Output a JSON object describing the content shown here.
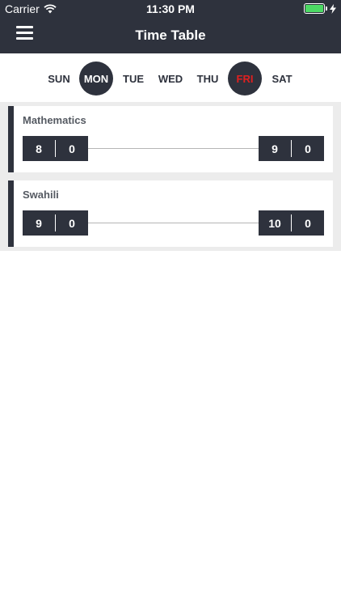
{
  "status_bar": {
    "carrier": "Carrier",
    "time": "11:30 PM",
    "battery_color": "#4cd964"
  },
  "header": {
    "title": "Time Table",
    "menu_icon": "hamburger-menu-icon",
    "background": "#2e323d"
  },
  "days": [
    {
      "label": "SUN",
      "state": "normal"
    },
    {
      "label": "MON",
      "state": "selected"
    },
    {
      "label": "TUE",
      "state": "normal"
    },
    {
      "label": "WED",
      "state": "normal"
    },
    {
      "label": "THU",
      "state": "normal"
    },
    {
      "label": "FRI",
      "state": "today"
    },
    {
      "label": "SAT",
      "state": "normal"
    }
  ],
  "colors": {
    "accent": "#2e323d",
    "today_text": "#e02020",
    "list_background": "#ececec"
  },
  "periods": [
    {
      "subject": "Mathematics",
      "start": {
        "hour": "8",
        "minute": "0"
      },
      "end": {
        "hour": "9",
        "minute": "0"
      }
    },
    {
      "subject": "Swahili",
      "start": {
        "hour": "9",
        "minute": "0"
      },
      "end": {
        "hour": "10",
        "minute": "0"
      }
    }
  ]
}
